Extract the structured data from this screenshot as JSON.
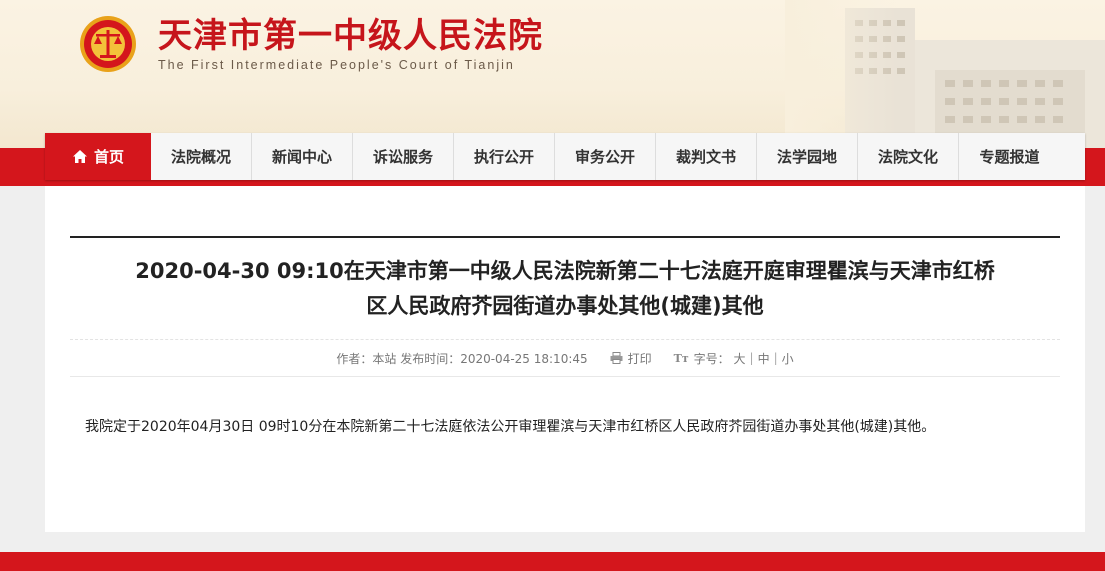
{
  "site": {
    "title": "天津市第一中级人民法院",
    "subtitle": "The First Intermediate People's Court of Tianjin"
  },
  "nav": {
    "items": [
      {
        "label": "首页",
        "active": true
      },
      {
        "label": "法院概况"
      },
      {
        "label": "新闻中心"
      },
      {
        "label": "诉讼服务"
      },
      {
        "label": "执行公开"
      },
      {
        "label": "审务公开"
      },
      {
        "label": "裁判文书"
      },
      {
        "label": "法学园地"
      },
      {
        "label": "法院文化"
      },
      {
        "label": "专题报道"
      }
    ]
  },
  "article": {
    "title_line1": "2020-04-30 09:10在天津市第一中级人民法院新第二十七法庭开庭审理瞿滨与天津市红桥",
    "title_line2": "区人民政府芥园街道办事处其他(城建)其他",
    "meta": {
      "author": "作者：本站",
      "published": "发布时间：2020-04-25 18:10:45",
      "print": "打印",
      "font_size_label": "字号：",
      "size_large": "大",
      "size_medium": "中",
      "size_small": "小"
    },
    "body": "我院定于2020年04月30日 09时10分在本院新第二十七法庭依法公开审理瞿滨与天津市红桥区人民政府芥园街道办事处其他(城建)其他。"
  },
  "colors": {
    "brand_red": "#d4161c",
    "title_red": "#c6151b",
    "header_bg": "#fbf3e3"
  },
  "icons": {
    "emblem": "national-emblem-icon",
    "home": "home-icon",
    "print": "printer-icon",
    "font": "font-size-icon"
  }
}
